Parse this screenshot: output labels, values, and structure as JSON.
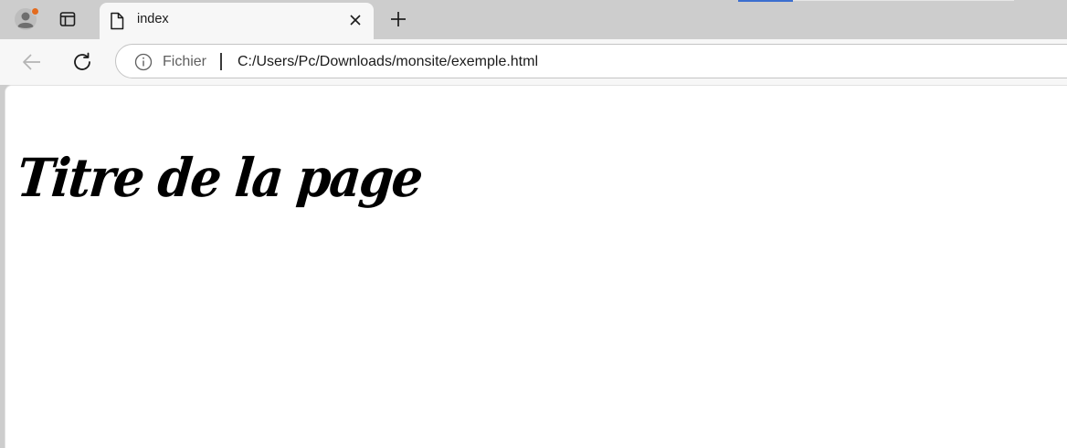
{
  "tab": {
    "title": "index"
  },
  "toolbar": {
    "scheme_label": "Fichier",
    "url": "C:/Users/Pc/Downloads/monsite/exemple.html"
  },
  "page": {
    "heading": "Titre de la page"
  },
  "icons": {
    "profile": "profile-icon",
    "tab_actions": "tab-actions-icon",
    "favicon": "file-icon",
    "close": "close-icon",
    "new_tab": "plus-icon",
    "back": "back-arrow-icon",
    "reload": "reload-icon",
    "info": "info-icon"
  },
  "colors": {
    "tab_strip": "#cdcdcd",
    "toolbar": "#f7f7f7",
    "profile_badge": "#e36b1e",
    "accent": "#3c6fcf"
  }
}
